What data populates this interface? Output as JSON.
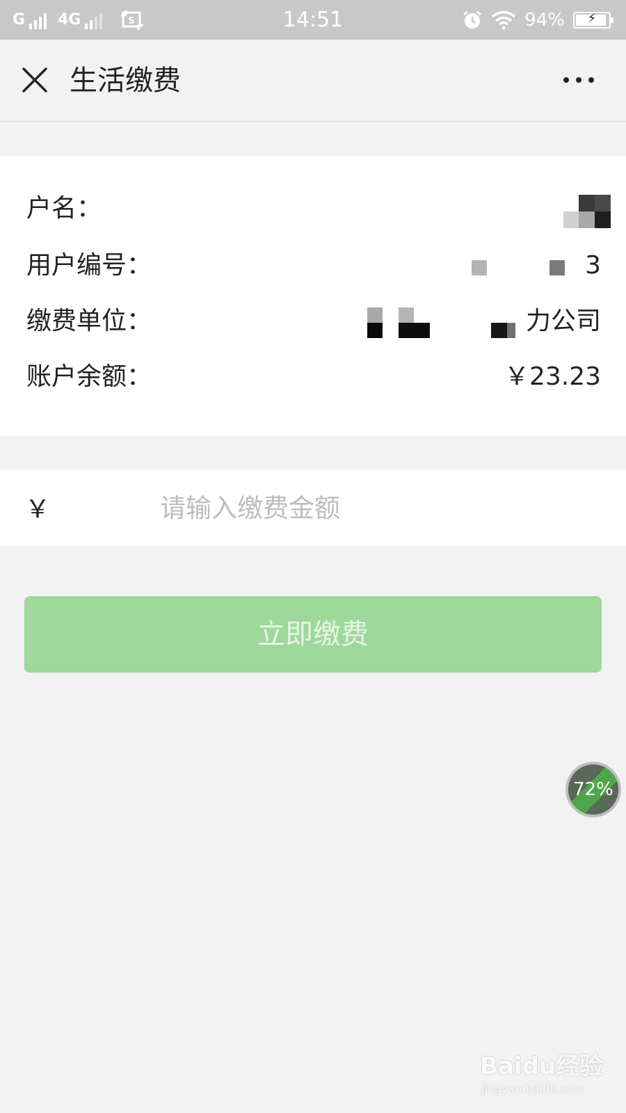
{
  "status_bar": {
    "network_1": "G",
    "network_2": "4G",
    "time": "14:51",
    "battery_percent": "94%",
    "battery_level": 0.94
  },
  "nav": {
    "title": "生活缴费",
    "close_icon": "close-icon",
    "more_icon": "more-icon"
  },
  "account": {
    "name_label": "户名：",
    "number_label": "用户编号：",
    "number_value_suffix": "3",
    "company_label": "缴费单位：",
    "company_value_suffix": "力公司",
    "balance_label": "账户余额：",
    "balance_value": "￥23.23"
  },
  "payment": {
    "currency_symbol": "￥",
    "amount_placeholder": "请输入缴费金额",
    "amount_value": "",
    "pay_button_label": "立即缴费"
  },
  "colors": {
    "primary_button": "#9ed89b",
    "background": "#f2f2f2",
    "status_bar": "#c8c8c8"
  },
  "float_badge": {
    "percent": "72%"
  },
  "watermark": {
    "brand": "Baidu经验",
    "url": "jingyan.baidu.com"
  }
}
